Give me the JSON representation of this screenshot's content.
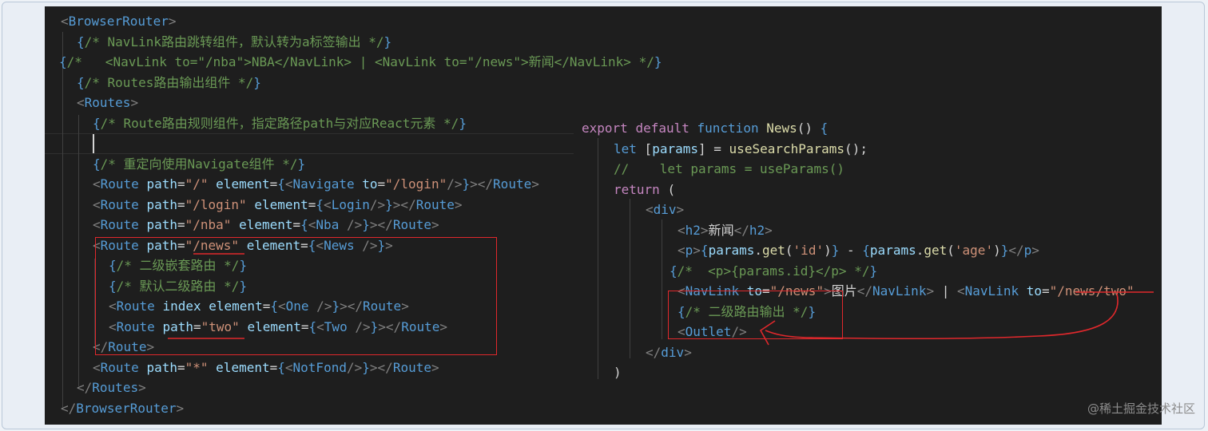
{
  "left_lines": [
    "<BrowserRouter>",
    "{/* NavLink路由跳转组件，默认转为a标签输出 */}",
    "{/*   <NavLink to=\"/nba\">NBA</NavLink> | <NavLink to=\"/news\">新闻</NavLink> */}",
    "{/* Routes路由输出组件 */}",
    "<Routes>",
    "{/* Route路由规则组件，指定路径path与对应React元素 */}",
    "",
    "{/* 重定向使用Navigate组件 */}",
    "<Route path=\"/\" element={<Navigate to=\"/login\"/>}></Route>",
    "<Route path=\"/login\" element={<Login/>}></Route>",
    "<Route path=\"/nba\" element={<Nba />}></Route>",
    "<Route path=\"/news\" element={<News />}>",
    "{/* 二级嵌套路由 */}",
    "{/* 默认二级路由 */}",
    "<Route index element={<One />}></Route>",
    "<Route path=\"two\" element={<Two />}></Route>",
    "</Route>",
    "<Route path=\"*\" element={<NotFond/>}></Route>",
    "</Routes>",
    "</BrowserRouter>"
  ],
  "right_lines": [
    "export default function News() {",
    "let [params] = useSearchParams();",
    "//    let params = useParams()",
    "return (",
    "<div>",
    "<h2>新闻</h2>",
    "<p>{params.get('id')} - {params.get('age')}</p>",
    "{/*  <p>{params.id}</p> */}",
    "<NavLink to=\"/news\">图片</NavLink> | <NavLink to=\"/news/two\"",
    "{/* 二级路由输出 */}",
    "<Outlet/>",
    "</div>",
    ")"
  ],
  "watermark": "@稀土掘金技术社区",
  "colors": {
    "annotation_red": "#e0282c",
    "editor_bg": "#1e1e1e",
    "tag": "#569cd6",
    "attr": "#9cdcfe",
    "string": "#ce9178",
    "comment": "#6a9955",
    "function": "#dcdcaa",
    "keyword": "#c586c0"
  }
}
